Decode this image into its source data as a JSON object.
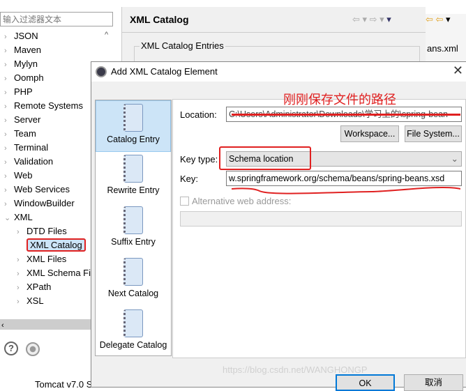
{
  "filter": {
    "placeholder": "输入过滤器文本"
  },
  "tree": [
    "JSON",
    "Maven",
    "Mylyn",
    "Oomph",
    "PHP",
    "Remote Systems",
    "Server",
    "Team",
    "Terminal",
    "Validation",
    "Web",
    "Web Services",
    "WindowBuilder",
    "XML"
  ],
  "tree_children": [
    "DTD Files",
    "XML Catalog",
    "XML Files",
    "XML Schema Fi",
    "XPath",
    "XSL"
  ],
  "page": {
    "title": "XML Catalog",
    "group": "XML Catalog Entries",
    "editor_tab": "ans.xml"
  },
  "bottom_text": "Tomcat v7.0 S",
  "dialog": {
    "title": "Add XML Catalog Element",
    "categories": [
      "Catalog Entry",
      "Rewrite Entry",
      "Suffix Entry",
      "Next Catalog",
      "Delegate Catalog"
    ],
    "annotation": "刚刚保存文件的路径",
    "location_label": "Location:",
    "location_value": "C:\\Users\\Administrator\\Downloads\\学习上的\\spring-bean",
    "workspace_button": "Workspace...",
    "filesystem_button": "File System...",
    "key_type_label": "Key type:",
    "key_type_value": "Schema location",
    "key_label": "Key:",
    "key_value": "w.springframework.org/schema/beans/spring-beans.xsd",
    "alt_label": "Alternative web address:",
    "ok": "OK",
    "cancel": "取消",
    "watermark": "https://blog.csdn.net/WANGHONGP"
  }
}
